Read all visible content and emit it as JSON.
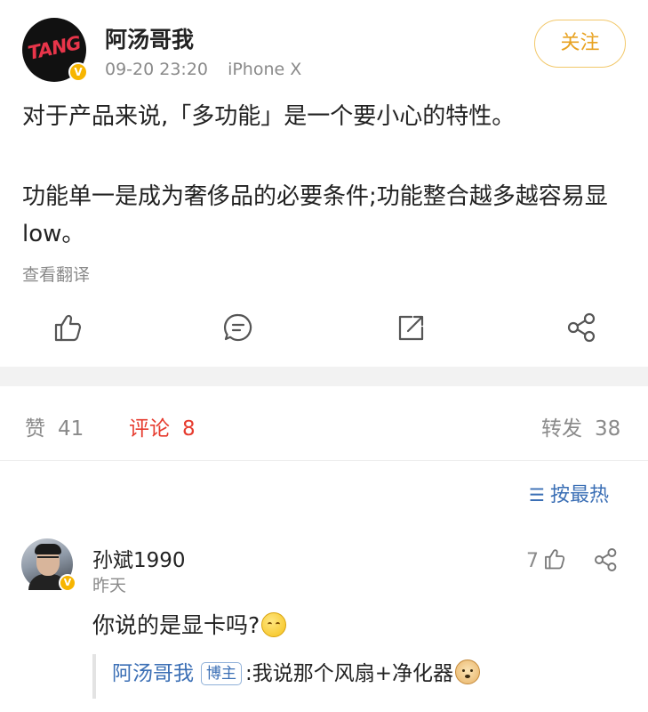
{
  "post": {
    "author": {
      "name": "阿汤哥我",
      "avatar_logo_text": "TANG",
      "verified_badge": "V"
    },
    "meta": {
      "time": "09-20 23:20",
      "device": "iPhone X"
    },
    "follow_label": "关注",
    "body": {
      "line1": "对于产品来说,「多功能」是一个要小心的特性。",
      "line2": "功能单一是成为奢侈品的必要条件;功能整合越多越容易显 low。"
    },
    "translate_label": "查看翻译",
    "actions": [
      {
        "icon": "thumbs-up-icon"
      },
      {
        "icon": "comment-icon"
      },
      {
        "icon": "repost-icon"
      },
      {
        "icon": "share-icon"
      }
    ]
  },
  "stats": {
    "likes": {
      "label": "赞",
      "count": "41"
    },
    "comments": {
      "label": "评论",
      "count": "8"
    },
    "reposts": {
      "label": "转发",
      "count": "38"
    }
  },
  "sort": {
    "icon_glyph": "☰",
    "label": "按最热"
  },
  "comments": [
    {
      "author": "孙斌1990",
      "verified_badge": "V",
      "time": "昨天",
      "likes": "7",
      "text": "你说的是显卡吗?",
      "reply": {
        "author": "阿汤哥我",
        "tag": "博主",
        "text": ":我说那个风扇+净化器"
      }
    }
  ],
  "colors": {
    "accent_red": "#e63b2e",
    "link_blue": "#3b6fb5",
    "follow_gold": "#e8a221",
    "verified_gold": "#f7b500",
    "muted_gray": "#8a8a8a"
  }
}
